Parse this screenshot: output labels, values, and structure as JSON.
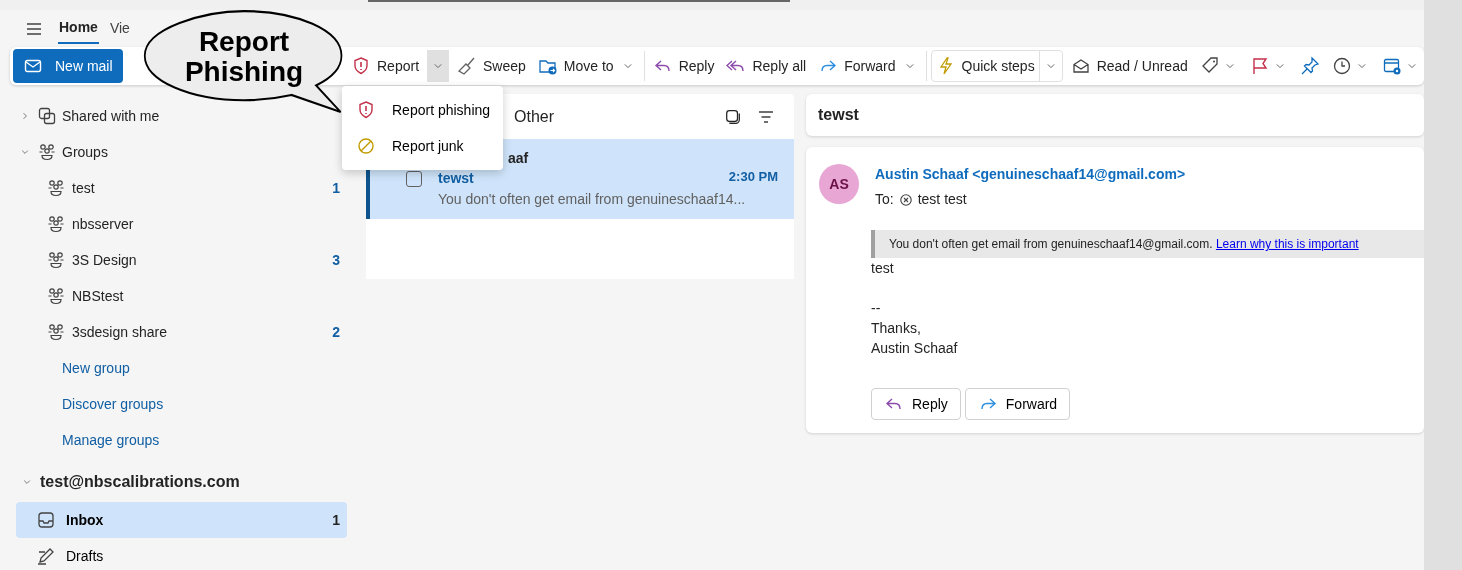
{
  "tabs": [
    {
      "label": "Home",
      "selected": true
    },
    {
      "label": "Vie",
      "selected": false
    }
  ],
  "callout": {
    "text": "Report Phishing"
  },
  "toolbar": {
    "new_mail": "New mail",
    "items": [
      {
        "kind": "split",
        "label": "Report",
        "expanded": true
      },
      {
        "kind": "button",
        "label": "Sweep"
      },
      {
        "kind": "menu",
        "label": "Move to"
      },
      {
        "kind": "button",
        "label": "Reply"
      },
      {
        "kind": "button",
        "label": "Reply all"
      },
      {
        "kind": "menu",
        "label": "Forward"
      },
      {
        "kind": "boxed",
        "label": "Quick steps"
      },
      {
        "kind": "button",
        "label": "Read / Unread"
      },
      {
        "kind": "icon_menu"
      },
      {
        "kind": "icon_menu"
      },
      {
        "kind": "icon"
      },
      {
        "kind": "icon_menu"
      },
      {
        "kind": "icon_menu"
      }
    ]
  },
  "report_menu": {
    "items": [
      "Report phishing",
      "Report junk"
    ]
  },
  "sidebar": {
    "sections": [
      {
        "label": "Shared with me",
        "expanded": false
      },
      {
        "label": "Groups",
        "expanded": true,
        "children": [
          {
            "label": "test",
            "count": "1"
          },
          {
            "label": "nbsserver"
          },
          {
            "label": "3S Design",
            "count": "3"
          },
          {
            "label": "NBStest"
          },
          {
            "label": "3sdesign share",
            "count": "2"
          }
        ],
        "links": [
          "New group",
          "Discover groups",
          "Manage groups"
        ]
      }
    ],
    "account": {
      "label": "test@nbscalibrations.com",
      "expanded": true,
      "folders": [
        {
          "label": "Inbox",
          "count": "1",
          "selected": true
        },
        {
          "label": "Drafts",
          "selected": false
        }
      ]
    }
  },
  "message_list": {
    "heading": "Other",
    "messages": [
      {
        "sender": "aaf",
        "subject": "tewst",
        "time": "2:30 PM",
        "preview": "You don't often get email from genuineschaaf14...",
        "selected": true,
        "checked": false
      }
    ]
  },
  "reading_pane": {
    "subject": "tewst",
    "message": {
      "avatar": "AS",
      "sender": "Austin Schaaf <genuineschaaf14@gmail.com>",
      "to_label": "To:",
      "recipient": "test test",
      "notice": "You don't often get email from genuineschaaf14@gmail.com.",
      "notice_link": "Learn why this is important",
      "body": [
        [
          "test"
        ],
        [
          "--",
          "Thanks,",
          "Austin Schaaf"
        ]
      ],
      "actions": [
        "Reply",
        "Forward"
      ]
    }
  }
}
